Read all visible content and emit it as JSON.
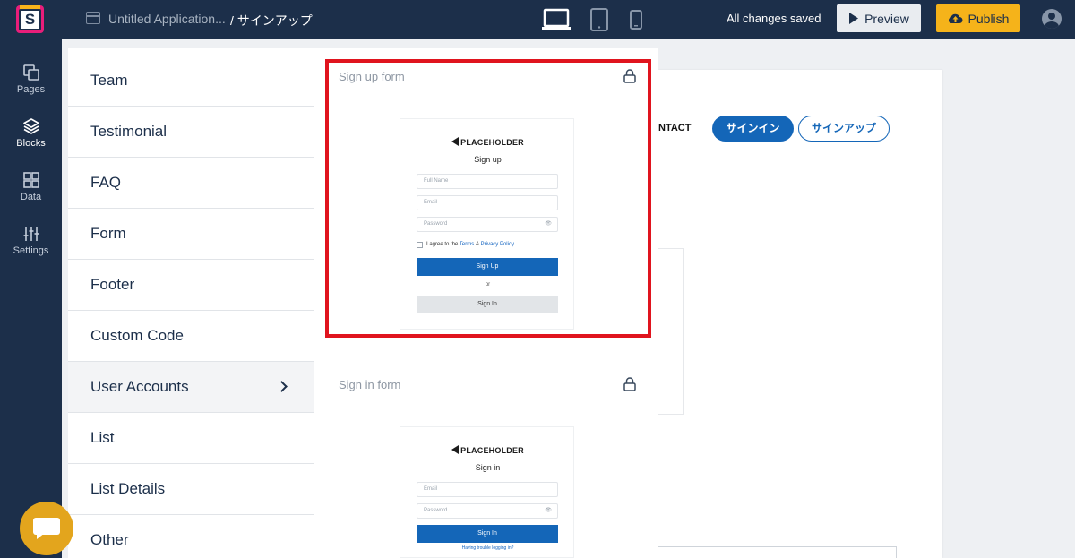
{
  "header": {
    "app_title": "Untitled Application...",
    "breadcrumb": "/ サインアップ",
    "status": "All changes saved",
    "preview_label": "Preview",
    "publish_label": "Publish",
    "devices": [
      "laptop-icon",
      "tablet-icon",
      "phone-icon"
    ],
    "selected_device": "laptop"
  },
  "rail": {
    "items": [
      {
        "label": "Pages",
        "icon": "pages-icon"
      },
      {
        "label": "Blocks",
        "icon": "blocks-icon"
      },
      {
        "label": "Data",
        "icon": "data-icon"
      },
      {
        "label": "Settings",
        "icon": "sliders-icon"
      }
    ],
    "active": "Blocks"
  },
  "categories": {
    "items": [
      "Team",
      "Testimonial",
      "FAQ",
      "Form",
      "Footer",
      "Custom Code",
      "User Accounts",
      "List",
      "List Details",
      "Other"
    ],
    "active": "User Accounts"
  },
  "templates": {
    "signup": {
      "label": "Sign up form",
      "logo": "PLACEHOLDER",
      "title": "Sign up",
      "full_name_placeholder": "Full Name",
      "email_placeholder": "Email",
      "password_placeholder": "Password",
      "agree_prefix": "I agree to the",
      "terms": "Terms",
      "amp": "&",
      "privacy": "Privacy Policy",
      "primary": "Sign Up",
      "or": "or",
      "secondary": "Sign In"
    },
    "signin": {
      "label": "Sign in form",
      "logo": "PLACEHOLDER",
      "title": "Sign in",
      "email_placeholder": "Email",
      "password_placeholder": "Password",
      "primary": "Sign In",
      "trouble": "Having trouble logging in?"
    }
  },
  "canvas": {
    "nav_text": "NTACT",
    "signin_button": "サインイン",
    "signup_button": "サインアップ"
  },
  "colors": {
    "navy": "#1c2f4a",
    "accent_yellow": "#f5b31a",
    "primary_blue": "#1466b8",
    "highlight_red": "#e0141e"
  }
}
